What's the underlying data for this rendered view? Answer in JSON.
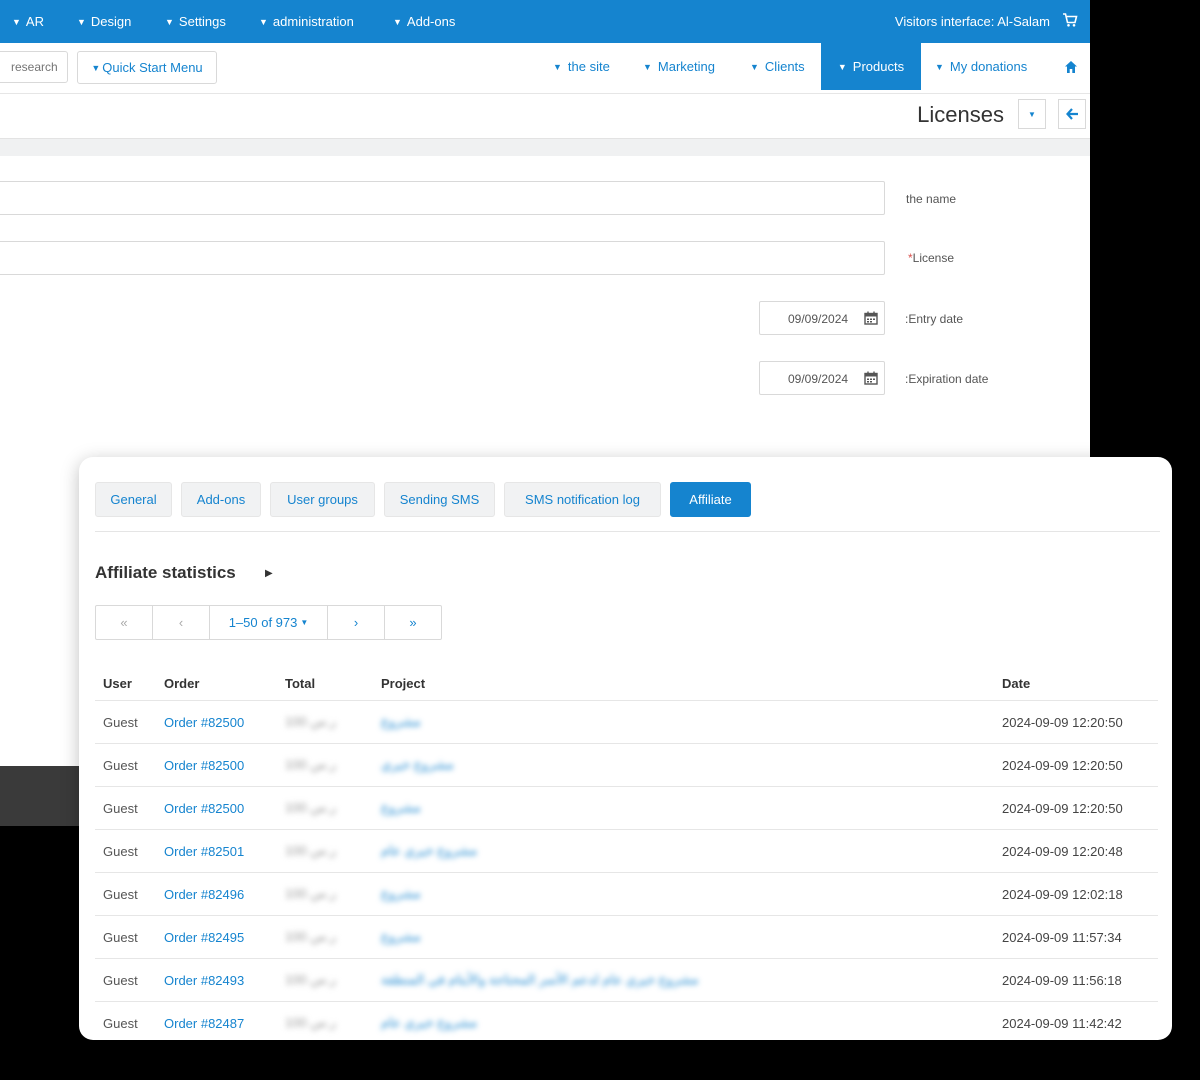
{
  "topbar": {
    "menus": [
      "AR",
      "Design",
      "Settings",
      "administration",
      "Add-ons"
    ],
    "visitors": "Visitors interface: Al-Salam",
    "bg_color": "#1584cf"
  },
  "toolbar": {
    "search_placeholder": "research",
    "quick_start": "Quick Start Menu",
    "nav": [
      "the site",
      "Marketing",
      "Clients",
      "Products",
      "My donations"
    ],
    "active_nav": "Products"
  },
  "page": {
    "title": "Licenses"
  },
  "form": {
    "name_label": "the name",
    "license_label": "License",
    "license_required": "*",
    "entry_date_label": ":Entry date",
    "entry_date_value": "09/09/2024",
    "expiration_date_label": ":Expiration date",
    "expiration_date_value": "09/09/2024"
  },
  "tabs": {
    "items": [
      "General",
      "Add-ons",
      "User groups",
      "Sending SMS",
      "SMS notification log",
      "Affiliate"
    ],
    "active": "Affiliate"
  },
  "affiliate": {
    "title": "Affiliate statistics",
    "pager": {
      "first": "«",
      "prev": "‹",
      "info": "1–50 of 973",
      "next": "›",
      "last": "»"
    },
    "columns": [
      "User",
      "Order",
      "Total",
      "Project",
      "Date"
    ],
    "rows": [
      {
        "user": "Guest",
        "order": "Order #82500",
        "total": "100 ر.س",
        "project": "مشروع",
        "date": "2024-09-09 12:20:50"
      },
      {
        "user": "Guest",
        "order": "Order #82500",
        "total": "100 ر.س",
        "project": "مشروع خيري",
        "date": "2024-09-09 12:20:50"
      },
      {
        "user": "Guest",
        "order": "Order #82500",
        "total": "100 ر.س",
        "project": "مشروع",
        "date": "2024-09-09 12:20:50"
      },
      {
        "user": "Guest",
        "order": "Order #82501",
        "total": "100 ر.س",
        "project": "مشروع خيري عام",
        "date": "2024-09-09 12:20:48"
      },
      {
        "user": "Guest",
        "order": "Order #82496",
        "total": "100 ر.س",
        "project": "مشروع",
        "date": "2024-09-09 12:02:18"
      },
      {
        "user": "Guest",
        "order": "Order #82495",
        "total": "100 ر.س",
        "project": "مشروع",
        "date": "2024-09-09 11:57:34"
      },
      {
        "user": "Guest",
        "order": "Order #82493",
        "total": "100 ر.س",
        "project": "مشروع خيري عام لدعم الأسر المحتاجة والأيتام في المنطقة",
        "date": "2024-09-09 11:56:18"
      },
      {
        "user": "Guest",
        "order": "Order #82487",
        "total": "100 ر.س",
        "project": "مشروع خيري عام",
        "date": "2024-09-09 11:42:42"
      }
    ]
  }
}
